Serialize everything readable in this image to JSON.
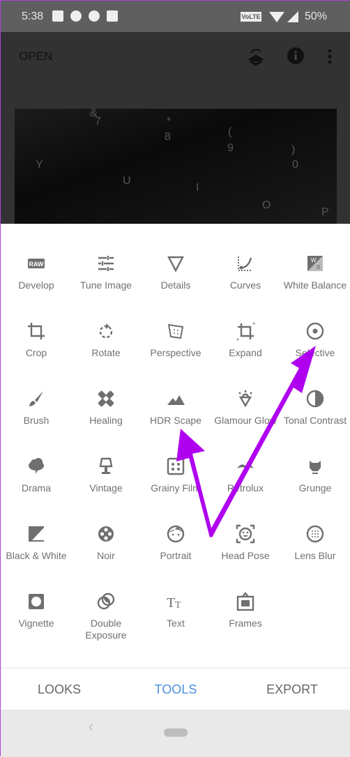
{
  "status_bar": {
    "time": "5:38",
    "network": "VoLTE",
    "battery": "50%"
  },
  "app_bar": {
    "open_label": "OPEN",
    "icons": [
      "layers-undo-icon",
      "info-icon",
      "more-vert-icon"
    ]
  },
  "photo_keys": [
    "&",
    "7",
    "*",
    "8",
    "(",
    "9",
    ")",
    "0",
    "Y",
    "U",
    "I",
    "O",
    "P"
  ],
  "tools": [
    {
      "label": "Develop",
      "icon": "raw"
    },
    {
      "label": "Tune Image",
      "icon": "tune"
    },
    {
      "label": "Details",
      "icon": "details"
    },
    {
      "label": "Curves",
      "icon": "curves"
    },
    {
      "label": "White Balance",
      "icon": "wb"
    },
    {
      "label": "Crop",
      "icon": "crop"
    },
    {
      "label": "Rotate",
      "icon": "rotate"
    },
    {
      "label": "Perspective",
      "icon": "perspective"
    },
    {
      "label": "Expand",
      "icon": "expand"
    },
    {
      "label": "Selective",
      "icon": "selective"
    },
    {
      "label": "Brush",
      "icon": "brush"
    },
    {
      "label": "Healing",
      "icon": "healing"
    },
    {
      "label": "HDR Scape",
      "icon": "hdr"
    },
    {
      "label": "Glamour Glow",
      "icon": "glamour"
    },
    {
      "label": "Tonal Contrast",
      "icon": "tonal"
    },
    {
      "label": "Drama",
      "icon": "drama"
    },
    {
      "label": "Vintage",
      "icon": "vintage"
    },
    {
      "label": "Grainy Film",
      "icon": "grainy"
    },
    {
      "label": "Retrolux",
      "icon": "retrolux"
    },
    {
      "label": "Grunge",
      "icon": "grunge"
    },
    {
      "label": "Black & White",
      "icon": "bw"
    },
    {
      "label": "Noir",
      "icon": "noir"
    },
    {
      "label": "Portrait",
      "icon": "portrait"
    },
    {
      "label": "Head Pose",
      "icon": "headpose"
    },
    {
      "label": "Lens Blur",
      "icon": "lensblur"
    },
    {
      "label": "Vignette",
      "icon": "vignette"
    },
    {
      "label": "Double Exposure",
      "icon": "double"
    },
    {
      "label": "Text",
      "icon": "text"
    },
    {
      "label": "Frames",
      "icon": "frames"
    }
  ],
  "tabs": [
    {
      "label": "LOOKS",
      "active": false
    },
    {
      "label": "TOOLS",
      "active": true
    },
    {
      "label": "EXPORT",
      "active": false
    }
  ],
  "colors": {
    "icon": "#6f6f6f",
    "active_tab": "#4a8fe0",
    "annotation_arrow": "#b000f0"
  }
}
